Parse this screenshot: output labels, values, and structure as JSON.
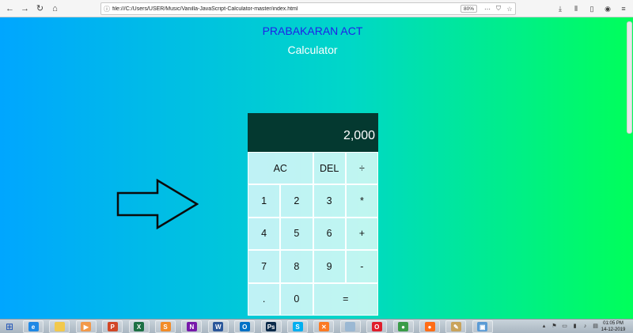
{
  "browser": {
    "url": "file:///C:/Users/USER/Music/Vanilla-JavaScript-Calculator-master/index.html",
    "zoom": "80%"
  },
  "page": {
    "author": "PRABAKARAN ACT",
    "title": "Calculator"
  },
  "calculator": {
    "display": "2,000",
    "keys": {
      "ac": "AC",
      "del": "DEL",
      "divide": "÷",
      "one": "1",
      "two": "2",
      "three": "3",
      "multiply": "*",
      "four": "4",
      "five": "5",
      "six": "6",
      "add": "+",
      "seven": "7",
      "eight": "8",
      "nine": "9",
      "subtract": "-",
      "decimal": ".",
      "zero": "0",
      "equals": "="
    }
  },
  "taskbar": {
    "apps": [
      {
        "name": "windows-explorer-ie-icon",
        "glyph": "e",
        "color": "#1e88e5"
      },
      {
        "name": "file-explorer-icon",
        "glyph": "",
        "color": "#f2c94c"
      },
      {
        "name": "media-player-icon",
        "glyph": "▶",
        "color": "#f2994a"
      },
      {
        "name": "powerpoint-icon",
        "glyph": "P",
        "color": "#d24726"
      },
      {
        "name": "excel-icon",
        "glyph": "X",
        "color": "#1d7044"
      },
      {
        "name": "sublime-text-icon",
        "glyph": "S",
        "color": "#f28c28"
      },
      {
        "name": "onenote-icon",
        "glyph": "N",
        "color": "#7719aa"
      },
      {
        "name": "word-icon",
        "glyph": "W",
        "color": "#2b579a"
      },
      {
        "name": "outlook-icon",
        "glyph": "O",
        "color": "#0072c6"
      },
      {
        "name": "photoshop-icon",
        "glyph": "Ps",
        "color": "#0b2a4a"
      },
      {
        "name": "skype-icon",
        "glyph": "S",
        "color": "#00aff0"
      },
      {
        "name": "xampp-icon",
        "glyph": "✕",
        "color": "#fb7a24"
      },
      {
        "name": "notepad-icon",
        "glyph": "",
        "color": "#9bb8d3"
      },
      {
        "name": "opera-icon",
        "glyph": "O",
        "color": "#e01e2b"
      },
      {
        "name": "chrome-icon",
        "glyph": "●",
        "color": "#3a9c48"
      },
      {
        "name": "firefox-icon",
        "glyph": "●",
        "color": "#ff6d17"
      },
      {
        "name": "paint-icon",
        "glyph": "✎",
        "color": "#c9a35b"
      },
      {
        "name": "remote-desktop-icon",
        "glyph": "▣",
        "color": "#5a9bd5"
      }
    ],
    "clock_time": "01:05 PM",
    "clock_date": "14-12-2019"
  }
}
